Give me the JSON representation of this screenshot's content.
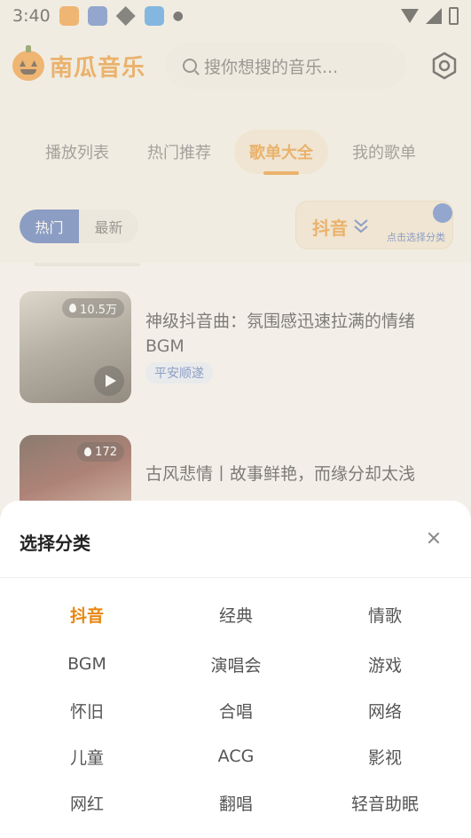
{
  "status_bar": {
    "time": "3:40"
  },
  "header": {
    "logo_text": "南瓜音乐",
    "search_placeholder": "搜你想搜的音乐..."
  },
  "tabs": [
    {
      "label": "播放列表"
    },
    {
      "label": "热门推荐"
    },
    {
      "label": "歌单大全"
    },
    {
      "label": "我的歌单"
    }
  ],
  "filters": {
    "hot": "热门",
    "latest": "最新"
  },
  "category_button": {
    "label": "抖音",
    "hint": "点击选择分类"
  },
  "playlists": [
    {
      "count": "10.5万",
      "title": "神级抖音曲：氛围感迅速拉满的情绪BGM",
      "tag": "平安顺遂"
    },
    {
      "count": "172",
      "title": "古风悲情丨故事鲜艳，而缘分却太浅"
    }
  ],
  "sheet": {
    "title": "选择分类",
    "categories": [
      "抖音",
      "经典",
      "情歌",
      "BGM",
      "演唱会",
      "游戏",
      "怀旧",
      "合唱",
      "网络",
      "儿童",
      "ACG",
      "影视",
      "网红",
      "翻唱",
      "轻音助眠"
    ],
    "selected": "抖音"
  },
  "colors": {
    "accent": "#e8850f",
    "blue": "#3d5fb0"
  }
}
